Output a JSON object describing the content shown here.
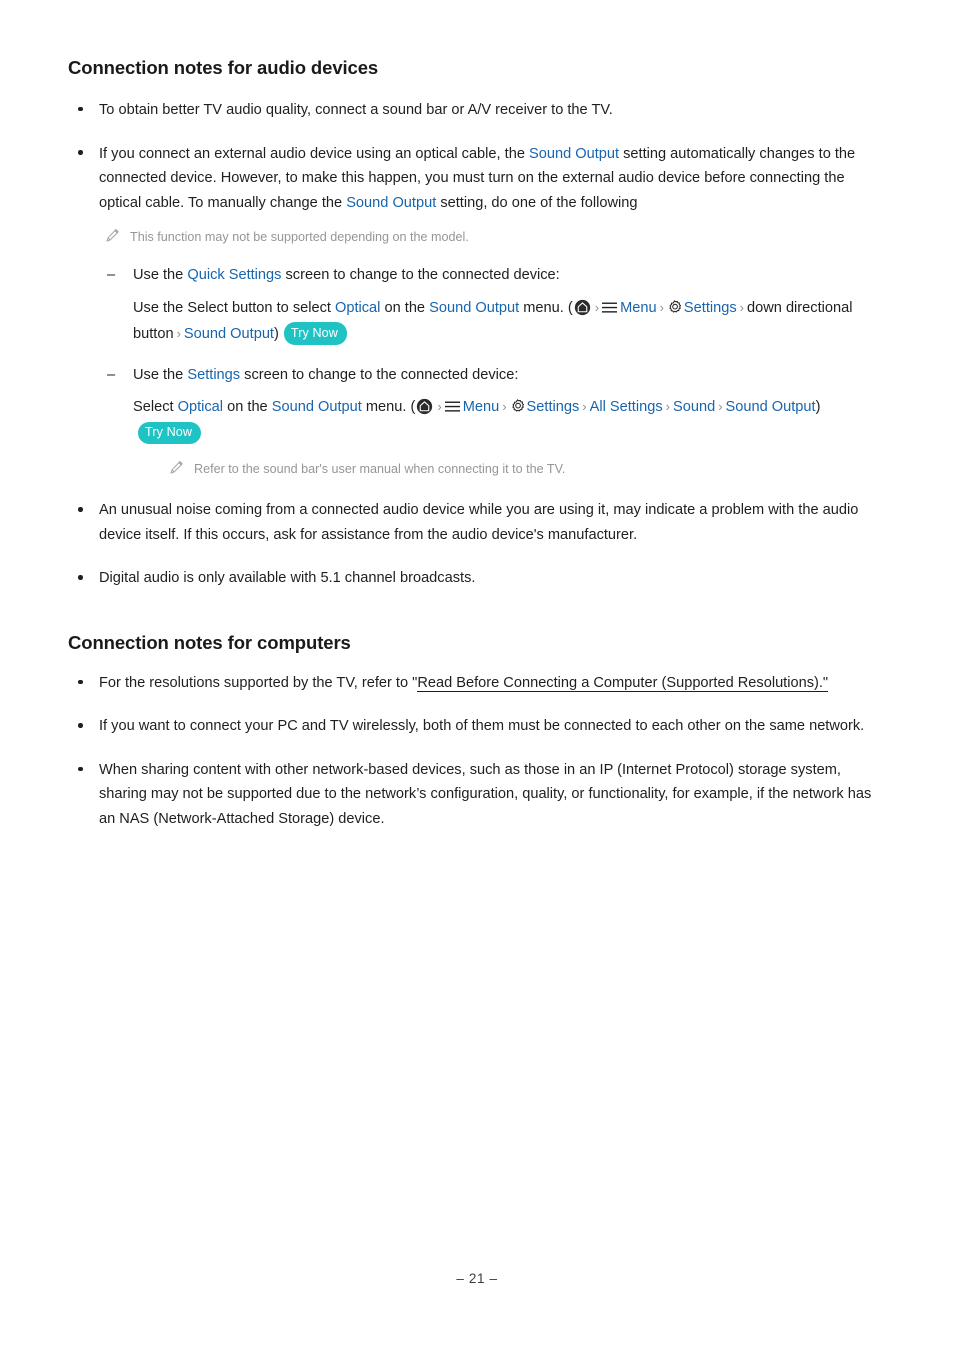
{
  "document": {
    "page_number": "– 21 –"
  },
  "sections": [
    {
      "heading": "Connection notes for audio devices",
      "bullets": {
        "b1": "To obtain better TV audio quality, connect a sound bar or A/V receiver to the TV.",
        "b2": {
          "part1": "If you connect an external audio device using an optical cable, the ",
          "link1": "Sound Output",
          "part2": " setting automatically changes to the connected device. However, to make this happen, you must turn on the external audio device before connecting the optical cable. To manually change the ",
          "link2": "Sound Output",
          "part3": " setting, do one of the following",
          "note": "This function may not be supported depending on the model.",
          "sub": [
            {
              "lead_part1": "Use the ",
              "lead_link": "Quick Settings",
              "lead_part2": " screen to change to the connected device:",
              "detail": {
                "part1": "Use the Select button to select ",
                "link_optical": "Optical",
                "part2": " on the ",
                "link_sound_output": "Sound Output",
                "part3": " menu. (",
                "icon_home": "home-icon",
                "icon_menu": "hamburger-menu-icon",
                "link_menu": "Menu",
                "icon_gear": "gear-icon",
                "link_settings": "Settings",
                "text_down": "down directional button",
                "link_sound_output2": "Sound Output",
                "close_paren": ")",
                "badge": "Try Now",
                "chevron": "›"
              }
            },
            {
              "lead_part1": "Use the ",
              "lead_link": "Settings",
              "lead_part2": " screen to change to the connected device:",
              "detail": {
                "part1": "Select ",
                "link_optical": "Optical",
                "part2": " on the ",
                "link_sound_output": "Sound Output",
                "part3": " menu. (",
                "icon_home": "home-icon",
                "icon_menu": "hamburger-menu-icon",
                "link_menu": "Menu",
                "icon_gear": "gear-icon",
                "link_settings": "Settings",
                "link_all_settings": "All Settings",
                "link_sound": "Sound",
                "link_sound_output2": "Sound Output",
                "close_paren": ")",
                "badge": "Try Now",
                "chevron": "›"
              },
              "note": "Refer to the sound bar's user manual when connecting it to the TV."
            }
          ]
        },
        "b3": "An unusual noise coming from a connected audio device while you are using it, may indicate a problem with the audio device itself. If this occurs, ask for assistance from the audio device's manufacturer.",
        "b4": "Digital audio is only available with 5.1 channel broadcasts."
      }
    },
    {
      "heading": "Connection notes for computers",
      "bullets": {
        "c1": {
          "part1": "For the resolutions supported by the TV, refer to \"",
          "link": "Read Before Connecting a Computer (Supported Resolutions).\"",
          "part2": ""
        },
        "c2": "If you want to connect your PC and TV wirelessly, both of them must be connected to each other on the same network.",
        "c3": "When sharing content with other network-based devices, such as those in an IP (Internet Protocol) storage system, sharing may not be supported due to the network’s configuration, quality, or functionality, for example, if the network has an NAS (Network-Attached Storage) device."
      }
    }
  ],
  "colors": {
    "link_blue": "#1765ad",
    "badge_teal": "#20c3c4",
    "note_gray": "#969696",
    "text": "#1f1f1f"
  }
}
